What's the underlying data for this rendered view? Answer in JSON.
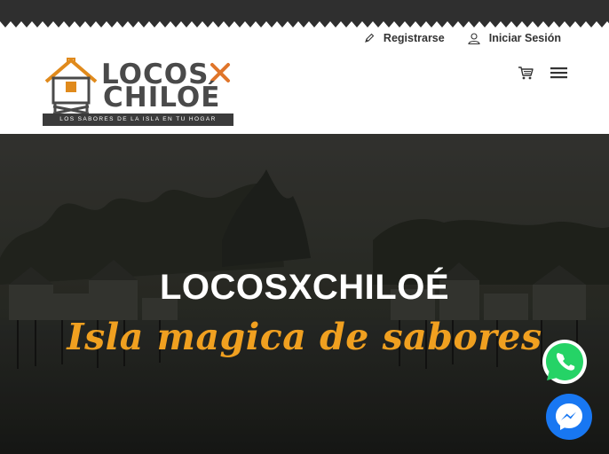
{
  "header": {
    "register_label": "Registrarse",
    "login_label": "Iniciar Sesión",
    "cart_icon": "cart-icon",
    "menu_icon": "hamburger-menu-icon"
  },
  "logo": {
    "line1": "LOCOS",
    "line2": "CHILOÉ",
    "tagline": "LOS SABORES DE LA ISLA EN TU HOGAR"
  },
  "hero": {
    "title": "LOCOSXCHILOÉ",
    "subtitle": "Isla magica de sabores"
  },
  "floating": {
    "whatsapp_icon": "whatsapp-icon",
    "messenger_icon": "messenger-icon"
  },
  "colors": {
    "accent_orange": "#f0a020",
    "whatsapp_green": "#25d366",
    "messenger_blue": "#1877f2",
    "strip_dark": "#2f2f2f"
  }
}
